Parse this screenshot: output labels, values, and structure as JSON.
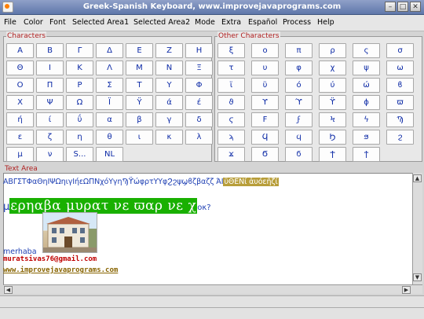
{
  "window": {
    "title": "Greek-Spanish Keyboard, www.improvejavaprograms.com",
    "minimize_label": "–",
    "maximize_label": "□",
    "close_label": "✕"
  },
  "menu": [
    "File",
    "Color",
    "Font",
    "Selected Area1",
    "Selected Area2",
    "Mode",
    "Extra",
    "Español",
    "Process",
    "Help"
  ],
  "characters": {
    "legend": "Characters",
    "keys": [
      "Α",
      "Β",
      "Γ",
      "Δ",
      "Ε",
      "Ζ",
      "Η",
      "Θ",
      "Ι",
      "Κ",
      "Λ",
      "Μ",
      "Ν",
      "Ξ",
      "Ο",
      "Π",
      "Ρ",
      "Σ",
      "Τ",
      "Υ",
      "Φ",
      "Χ",
      "Ψ",
      "Ω",
      "Ϊ",
      "Ϋ",
      "ά",
      "έ",
      "ή",
      "ί",
      "ΰ",
      "α",
      "β",
      "γ",
      "δ",
      "ε",
      "ζ",
      "η",
      "θ",
      "ι",
      "κ",
      "λ",
      "μ",
      "ν",
      "S...",
      "NL"
    ]
  },
  "other_characters": {
    "legend": "Other Characters",
    "keys": [
      "ξ",
      "ο",
      "π",
      "ρ",
      "ς",
      "σ",
      "τ",
      "υ",
      "φ",
      "χ",
      "ψ",
      "ω",
      "ϊ",
      "ϋ",
      "ό",
      "ύ",
      "ώ",
      "ϐ",
      "ϑ",
      "ϒ",
      "ϓ",
      "ϔ",
      "ϕ",
      "ϖ",
      "ϛ",
      "Ϝ",
      "ϝ",
      "Ϟ",
      "ϟ",
      "Ϡ",
      "ϡ",
      "Ϥ",
      "ϥ",
      "Ϧ",
      "ϧ",
      "ϩ",
      "ϫ",
      "Ϭ",
      "ϭ",
      "Ϯ",
      "ϯ"
    ]
  },
  "text_area": {
    "legend": "Text Area",
    "line1_text": "ΑΒΓΣΤΦαΘηΙΨΩηιγΙήεΩΠΝχόΥγηϠϔώφρτΥΥφϨϩψϣϐζβαζζ ΆΙ",
    "line1_highlight": "ΰΘΕΝί ἀυόεῆζί",
    "line2_prefix": "μ",
    "line2_highlight": "ερηαβα μυρατ νε ϖαρ νε χ",
    "line2_suffix": "οκ?",
    "small_text": "merhaba",
    "email": "muratsivas76@gmail.com",
    "url": "www.improvejavaprograms.com"
  },
  "colors": {
    "accent_red": "#b02020",
    "key_text": "#0c2aa6",
    "highlight_green": "#19b000",
    "highlight_orange": "#b89e3a"
  }
}
